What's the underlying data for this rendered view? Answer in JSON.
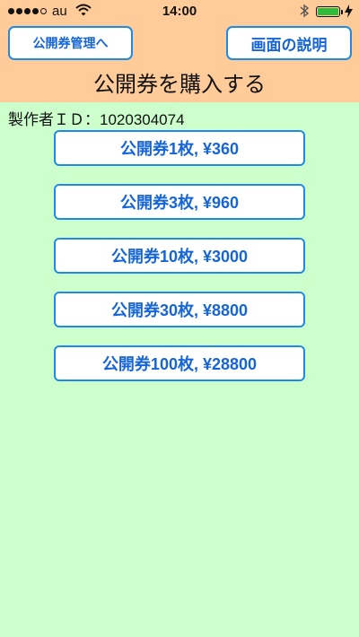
{
  "status_bar": {
    "carrier": "au",
    "time": "14:00",
    "signal_dots_filled": 4,
    "signal_dots_total": 5,
    "battery_level": 1.0,
    "battery_color": "#2cbd3a"
  },
  "header": {
    "manage_button_label": "公開券管理へ",
    "help_button_label": "画面の説明",
    "title": "公開券を購入する",
    "background_color": "#ffcc99"
  },
  "producer": {
    "label": "製作者ＩＤ：1020304074"
  },
  "purchase_options": [
    {
      "label": "公開券1枚, ¥360"
    },
    {
      "label": "公開券3枚, ¥960"
    },
    {
      "label": "公開券10枚, ¥3000"
    },
    {
      "label": "公開券30枚, ¥8800"
    },
    {
      "label": "公開券100枚, ¥28800"
    }
  ],
  "colors": {
    "page_background": "#ccffcc",
    "button_accent": "#1f8ae8",
    "button_text": "#1565d8"
  }
}
